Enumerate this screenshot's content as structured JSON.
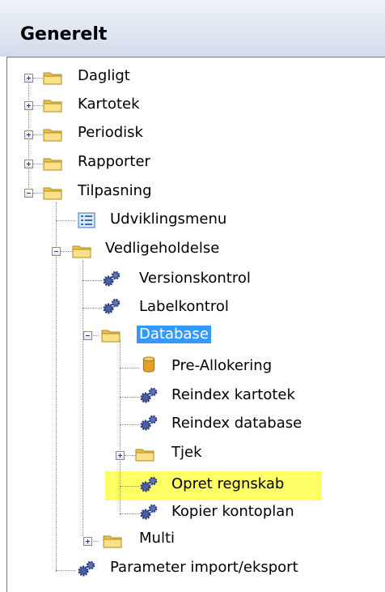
{
  "header": {
    "title": "Generelt"
  },
  "tree": {
    "items": [
      {
        "label": "Dagligt"
      },
      {
        "label": "Kartotek"
      },
      {
        "label": "Periodisk"
      },
      {
        "label": "Rapporter"
      },
      {
        "label": "Tilpasning"
      },
      {
        "label": "Udviklingsmenu"
      },
      {
        "label": "Vedligeholdelse"
      },
      {
        "label": "Versionskontrol"
      },
      {
        "label": "Labelkontrol"
      },
      {
        "label": "Database"
      },
      {
        "label": "Pre-Allokering"
      },
      {
        "label": "Reindex kartotek"
      },
      {
        "label": "Reindex database"
      },
      {
        "label": "Tjek"
      },
      {
        "label": "Opret regnskab"
      },
      {
        "label": "Kopier kontoplan"
      },
      {
        "label": "Multi"
      },
      {
        "label": "Parameter import/eksport"
      }
    ]
  },
  "colors": {
    "selection": "#3399ff",
    "highlight": "#ffff66",
    "header_bg": "#dfe6f1"
  }
}
